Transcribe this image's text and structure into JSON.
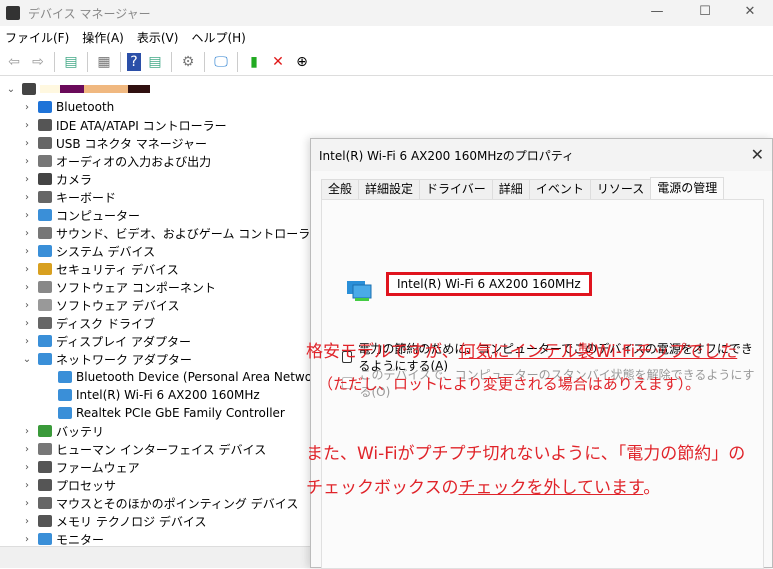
{
  "window": {
    "title": "デバイス マネージャー",
    "minimize": "—",
    "maximize": "☐",
    "close": "✕"
  },
  "menu": [
    "ファイル(F)",
    "操作(A)",
    "表示(V)",
    "ヘルプ(H)"
  ],
  "toolbar_icons": [
    "back-icon",
    "forward-icon",
    "show-hide-console-tree-icon",
    "properties-icon",
    "help-icon",
    "action-pane-icon",
    "update-driver-icon",
    "scan-hardware-icon",
    "enable-device-icon",
    "uninstall-device-icon",
    "disable-device-icon"
  ],
  "tree": {
    "items": [
      {
        "label": "Bluetooth",
        "color": "#1e73d8"
      },
      {
        "label": "IDE ATA/ATAPI コントローラー",
        "color": "#555"
      },
      {
        "label": "USB コネクタ マネージャー",
        "color": "#666"
      },
      {
        "label": "オーディオの入力および出力",
        "color": "#777"
      },
      {
        "label": "カメラ",
        "color": "#444"
      },
      {
        "label": "キーボード",
        "color": "#666"
      },
      {
        "label": "コンピューター",
        "color": "#3a8fd8"
      },
      {
        "label": "サウンド、ビデオ、およびゲーム コントローラー",
        "color": "#777"
      },
      {
        "label": "システム デバイス",
        "color": "#3a8fd8"
      },
      {
        "label": "セキュリティ デバイス",
        "color": "#d8a020"
      },
      {
        "label": "ソフトウェア コンポーネント",
        "color": "#888"
      },
      {
        "label": "ソフトウェア デバイス",
        "color": "#999"
      },
      {
        "label": "ディスク ドライブ",
        "color": "#666"
      },
      {
        "label": "ディスプレイ アダプター",
        "color": "#3a8fd8"
      },
      {
        "label": "ネットワーク アダプター",
        "color": "#3a8fd8",
        "expanded": true,
        "children": [
          "Bluetooth Device (Personal Area Network)",
          "Intel(R) Wi-Fi 6 AX200 160MHz",
          "Realtek PCIe GbE Family Controller"
        ]
      },
      {
        "label": "バッテリ",
        "color": "#3a9a3a"
      },
      {
        "label": "ヒューマン インターフェイス デバイス",
        "color": "#777"
      },
      {
        "label": "ファームウェア",
        "color": "#555"
      },
      {
        "label": "プロセッサ",
        "color": "#555"
      },
      {
        "label": "マウスとそのほかのポインティング デバイス",
        "color": "#666"
      },
      {
        "label": "メモリ テクノロジ デバイス",
        "color": "#555"
      },
      {
        "label": "モニター",
        "color": "#3a8fd8"
      }
    ]
  },
  "dialog": {
    "title": "Intel(R) Wi-Fi 6 AX200 160MHzのプロパティ",
    "tabs": [
      "全般",
      "詳細設定",
      "ドライバー",
      "詳細",
      "イベント",
      "リソース",
      "電源の管理"
    ],
    "active_tab": "電源の管理",
    "device_name": "Intel(R) Wi-Fi 6 AX200 160MHz",
    "checkbox1": {
      "label": "電力の節約のために、コンピューターでこのデバイスの電源をオフにできるようにする(A)",
      "checked": false
    },
    "checkbox2": {
      "label": "このデバイスで、コンピューターのスタンバイ状態を解除できるようにする(O)",
      "checked": false,
      "disabled": true
    }
  },
  "annotation": {
    "line1a": "格安モデルですが、",
    "line1b": "何気にインテル製Wi-Fiチップでした",
    "line2": "（ただし、ロットにより変更される場合はありえます）。",
    "line3": "また、Wi-Fiがプチプチ切れないように、「電力の節約」の",
    "line4a": "チェックボックスの",
    "line4b": "チェックを外しています",
    "line4c": "。",
    "color": "#e0242a"
  }
}
